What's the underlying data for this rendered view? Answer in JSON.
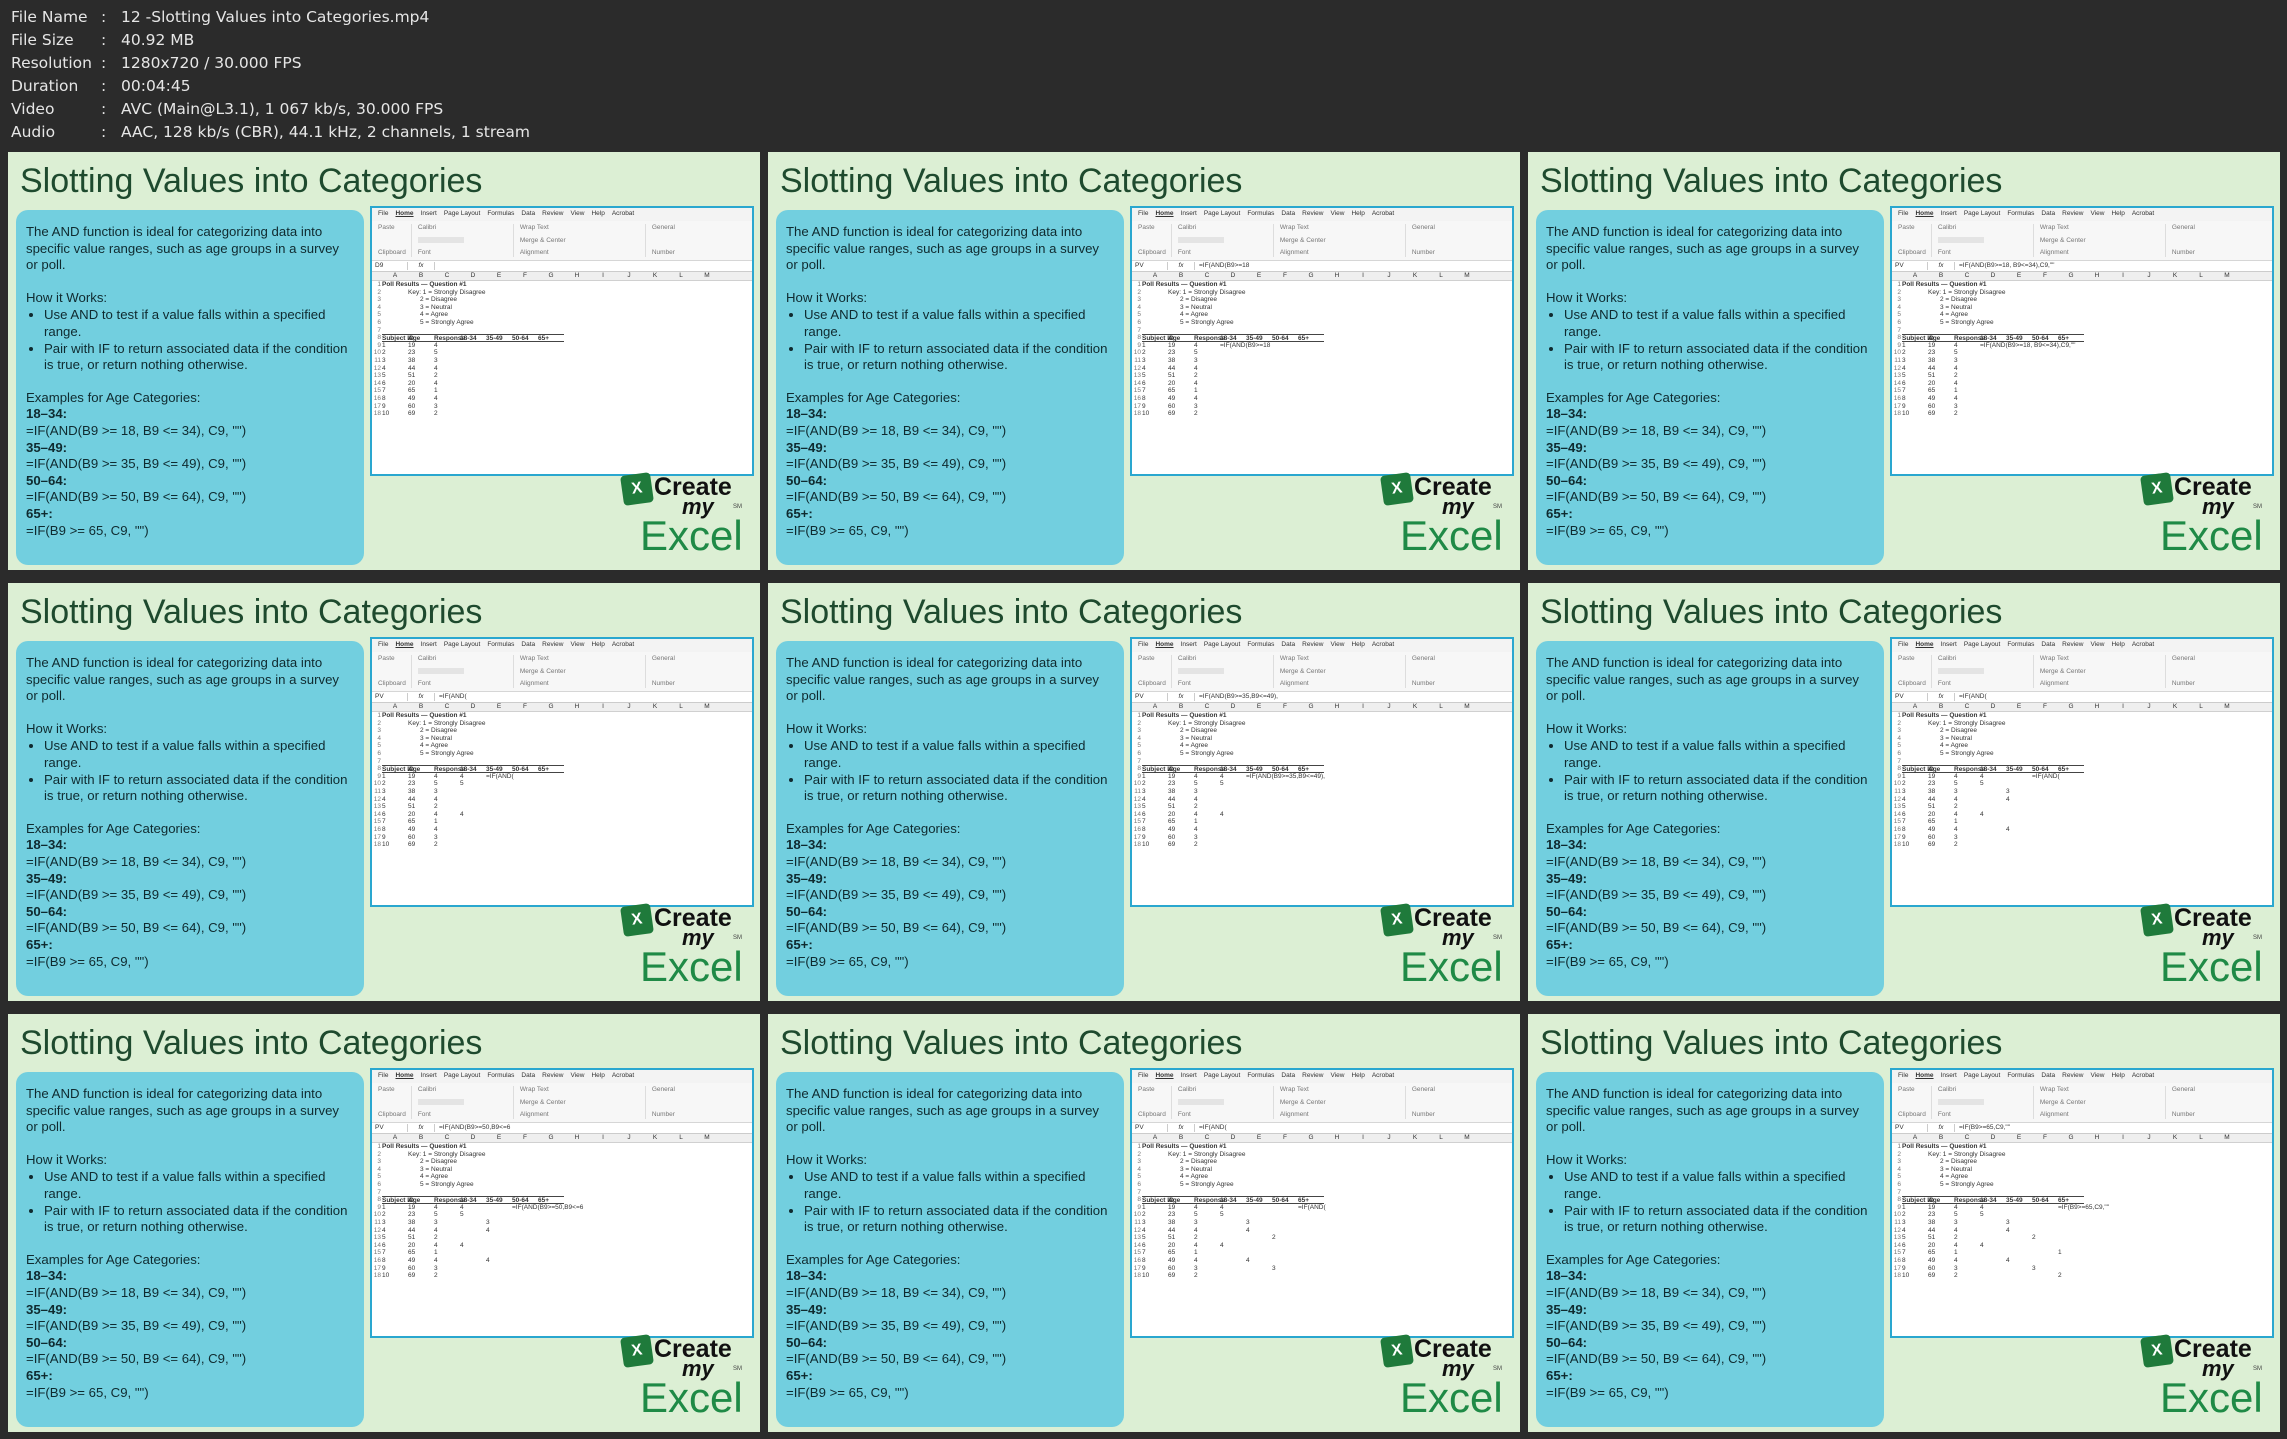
{
  "file_info": [
    {
      "key": "File Name",
      "value": "12 -Slotting Values into Categories.mp4"
    },
    {
      "key": "File Size",
      "value": "40.92 MB"
    },
    {
      "key": "Resolution",
      "value": "1280x720 / 30.000 FPS"
    },
    {
      "key": "Duration",
      "value": "00:04:45"
    },
    {
      "key": "Video",
      "value": "AVC (Main@L3.1), 1 067 kb/s, 30.000 FPS"
    },
    {
      "key": "Audio",
      "value": "AAC, 128 kb/s (CBR), 44.1 kHz, 2 channels, 1 stream"
    }
  ],
  "slide": {
    "title": "Slotting Values into Categories",
    "intro": "The AND function is ideal for categorizing data into specific value ranges, such as age groups in a survey or poll.",
    "how_heading": "How it Works:",
    "bullets": [
      "Use AND to test if a value falls within a specified range.",
      "Pair with IF to return associated data if the condition is true, or return nothing otherwise."
    ],
    "examples_heading": "Examples for Age Categories:",
    "examples": [
      {
        "label": "18–34:",
        "formula": "=IF(AND(B9 >= 18, B9 <= 34), C9, \"\")"
      },
      {
        "label": "35–49:",
        "formula": "=IF(AND(B9 >= 35, B9 <= 49), C9, \"\")"
      },
      {
        "label": "50–64:",
        "formula": "=IF(AND(B9 >= 50, B9 <= 64), C9, \"\")"
      },
      {
        "label": "65+:",
        "formula": "=IF(B9 >= 65, C9, \"\")"
      }
    ]
  },
  "logo": {
    "create": "Create",
    "my": "my",
    "excel": "Excel",
    "sm": "SM"
  },
  "excel": {
    "menu": [
      "File",
      "Home",
      "Insert",
      "Page Layout",
      "Formulas",
      "Data",
      "Review",
      "View",
      "Help",
      "Acrobat"
    ],
    "ribbon_groups": [
      "Clipboard",
      "Font",
      "Alignment",
      "Number"
    ],
    "ribbon_controls": {
      "wrap_text": "Wrap Text",
      "merge_center": "Merge & Center",
      "number_format": "General",
      "paste": "Paste",
      "font": "Calibri"
    },
    "column_heads": [
      "A",
      "B",
      "C",
      "D",
      "E",
      "F",
      "G",
      "H",
      "I",
      "J",
      "K",
      "L",
      "M"
    ],
    "poll_title": "Poll Results — Question #1",
    "key_lines": [
      "Key: 1 = Strongly Disagree",
      "2 = Disagree",
      "3 = Neutral",
      "4 = Agree",
      "5 = Strongly Agree"
    ],
    "table_headers": [
      "Subject ID",
      "Age",
      "Response",
      "18-34",
      "35-49",
      "50-64",
      "65+"
    ],
    "rows": [
      [
        "1",
        "19",
        "4"
      ],
      [
        "2",
        "23",
        "5"
      ],
      [
        "3",
        "38",
        "3"
      ],
      [
        "4",
        "44",
        "4"
      ],
      [
        "5",
        "51",
        "2"
      ],
      [
        "6",
        "20",
        "4"
      ],
      [
        "7",
        "65",
        "1"
      ],
      [
        "8",
        "49",
        "4"
      ],
      [
        "9",
        "60",
        "3"
      ],
      [
        "10",
        "69",
        "2"
      ]
    ]
  },
  "frames": [
    {
      "name_box": "D9",
      "formula": "",
      "results": [
        [
          "",
          "",
          "",
          ""
        ],
        [
          "",
          "",
          "",
          ""
        ],
        [
          "",
          "",
          "",
          ""
        ],
        [
          "",
          "",
          "",
          ""
        ],
        [
          "",
          "",
          "",
          ""
        ],
        [
          "",
          "",
          "",
          ""
        ],
        [
          "",
          "",
          "",
          ""
        ],
        [
          "",
          "",
          "",
          ""
        ],
        [
          "",
          "",
          "",
          ""
        ],
        [
          "",
          "",
          "",
          ""
        ]
      ]
    },
    {
      "name_box": "PV",
      "formula": "=IF(AND(B9>=18",
      "results": [
        [
          "=IF(AND(B9>=18",
          "",
          "",
          ""
        ],
        [
          "",
          "",
          "",
          ""
        ],
        [
          "",
          "",
          "",
          ""
        ],
        [
          "",
          "",
          "",
          ""
        ],
        [
          "",
          "",
          "",
          ""
        ],
        [
          "",
          "",
          "",
          ""
        ],
        [
          "",
          "",
          "",
          ""
        ],
        [
          "",
          "",
          "",
          ""
        ],
        [
          "",
          "",
          "",
          ""
        ],
        [
          "",
          "",
          "",
          ""
        ]
      ]
    },
    {
      "name_box": "PV",
      "formula": "=IF(AND(B9>=18, B9<=34),C9,\"\"",
      "results": [
        [
          "=IF(AND(B9>=18, B9<=34),C9,\"\"",
          "",
          "",
          ""
        ],
        [
          "",
          "",
          "",
          ""
        ],
        [
          "",
          "",
          "",
          ""
        ],
        [
          "",
          "",
          "",
          ""
        ],
        [
          "",
          "",
          "",
          ""
        ],
        [
          "",
          "",
          "",
          ""
        ],
        [
          "",
          "",
          "",
          ""
        ],
        [
          "",
          "",
          "",
          ""
        ],
        [
          "",
          "",
          "",
          ""
        ],
        [
          "",
          "",
          "",
          ""
        ]
      ]
    },
    {
      "name_box": "PV",
      "formula": "=IF(AND(",
      "results": [
        [
          "4",
          "=IF(AND(",
          "",
          ""
        ],
        [
          "5",
          "",
          "",
          ""
        ],
        [
          "",
          "",
          "",
          ""
        ],
        [
          "",
          "",
          "",
          ""
        ],
        [
          "",
          "",
          "",
          ""
        ],
        [
          "4",
          "",
          "",
          ""
        ],
        [
          "",
          "",
          "",
          ""
        ],
        [
          "",
          "",
          "",
          ""
        ],
        [
          "",
          "",
          "",
          ""
        ],
        [
          "",
          "",
          "",
          ""
        ]
      ]
    },
    {
      "name_box": "PV",
      "formula": "=IF(AND(B9>=35,B9<=49),",
      "results": [
        [
          "4",
          "=IF(AND(B9>=35,B9<=49),",
          "",
          ""
        ],
        [
          "5",
          "",
          "",
          ""
        ],
        [
          "",
          "",
          "",
          ""
        ],
        [
          "",
          "",
          "",
          ""
        ],
        [
          "",
          "",
          "",
          ""
        ],
        [
          "4",
          "",
          "",
          ""
        ],
        [
          "",
          "",
          "",
          ""
        ],
        [
          "",
          "",
          "",
          ""
        ],
        [
          "",
          "",
          "",
          ""
        ],
        [
          "",
          "",
          "",
          ""
        ]
      ]
    },
    {
      "name_box": "PV",
      "formula": "=IF(AND(",
      "results": [
        [
          "4",
          "",
          "=IF(AND(",
          ""
        ],
        [
          "5",
          "",
          "",
          ""
        ],
        [
          "",
          "3",
          "",
          ""
        ],
        [
          "",
          "4",
          "",
          ""
        ],
        [
          "",
          "",
          "",
          ""
        ],
        [
          "4",
          "",
          "",
          ""
        ],
        [
          "",
          "",
          "",
          ""
        ],
        [
          "",
          "4",
          "",
          ""
        ],
        [
          "",
          "",
          "",
          ""
        ],
        [
          "",
          "",
          "",
          ""
        ]
      ]
    },
    {
      "name_box": "PV",
      "formula": "=IF(AND(B9>=50,B9<=6",
      "results": [
        [
          "4",
          "",
          "=IF(AND(B9>=50,B9<=6",
          ""
        ],
        [
          "5",
          "",
          "",
          ""
        ],
        [
          "",
          "3",
          "",
          ""
        ],
        [
          "",
          "4",
          "",
          ""
        ],
        [
          "",
          "",
          "",
          ""
        ],
        [
          "4",
          "",
          "",
          ""
        ],
        [
          "",
          "",
          "",
          ""
        ],
        [
          "",
          "4",
          "",
          ""
        ],
        [
          "",
          "",
          "",
          ""
        ],
        [
          "",
          "",
          "",
          ""
        ]
      ]
    },
    {
      "name_box": "PV",
      "formula": "=IF(AND(",
      "results": [
        [
          "4",
          "",
          "",
          "=IF(AND("
        ],
        [
          "5",
          "",
          "",
          ""
        ],
        [
          "",
          "3",
          "",
          ""
        ],
        [
          "",
          "4",
          "",
          ""
        ],
        [
          "",
          "",
          "2",
          ""
        ],
        [
          "4",
          "",
          "",
          ""
        ],
        [
          "",
          "",
          "",
          ""
        ],
        [
          "",
          "4",
          "",
          ""
        ],
        [
          "",
          "",
          "3",
          ""
        ],
        [
          "",
          "",
          "",
          ""
        ]
      ]
    },
    {
      "name_box": "PV",
      "formula": "=IF(B9>=65,C9,\"\"",
      "results": [
        [
          "4",
          "",
          "",
          "=IF(B9>=65,C9,\"\""
        ],
        [
          "5",
          "",
          "",
          ""
        ],
        [
          "",
          "3",
          "",
          ""
        ],
        [
          "",
          "4",
          "",
          ""
        ],
        [
          "",
          "",
          "2",
          ""
        ],
        [
          "4",
          "",
          "",
          ""
        ],
        [
          "",
          "",
          "",
          "1"
        ],
        [
          "",
          "4",
          "",
          ""
        ],
        [
          "",
          "",
          "3",
          ""
        ],
        [
          "",
          "",
          "",
          "2"
        ]
      ]
    }
  ]
}
